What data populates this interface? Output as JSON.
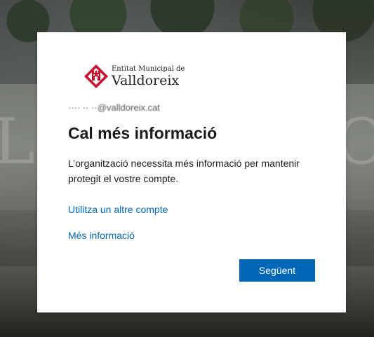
{
  "logo": {
    "line1": "Entitat Municipal de",
    "line2": "Valldoreix"
  },
  "identity": {
    "email": "···· ·· ··@valldoreix.cat"
  },
  "dialog": {
    "title": "Cal més informació",
    "description": "L’organització necessita més informació per mantenir protegit el vostre compte.",
    "links": {
      "other_account": "Utilitza un altre compte",
      "more_info": "Més informació"
    },
    "next_button": "Següent"
  },
  "colors": {
    "accent": "#0067b8",
    "logo_red": "#c8102e"
  }
}
